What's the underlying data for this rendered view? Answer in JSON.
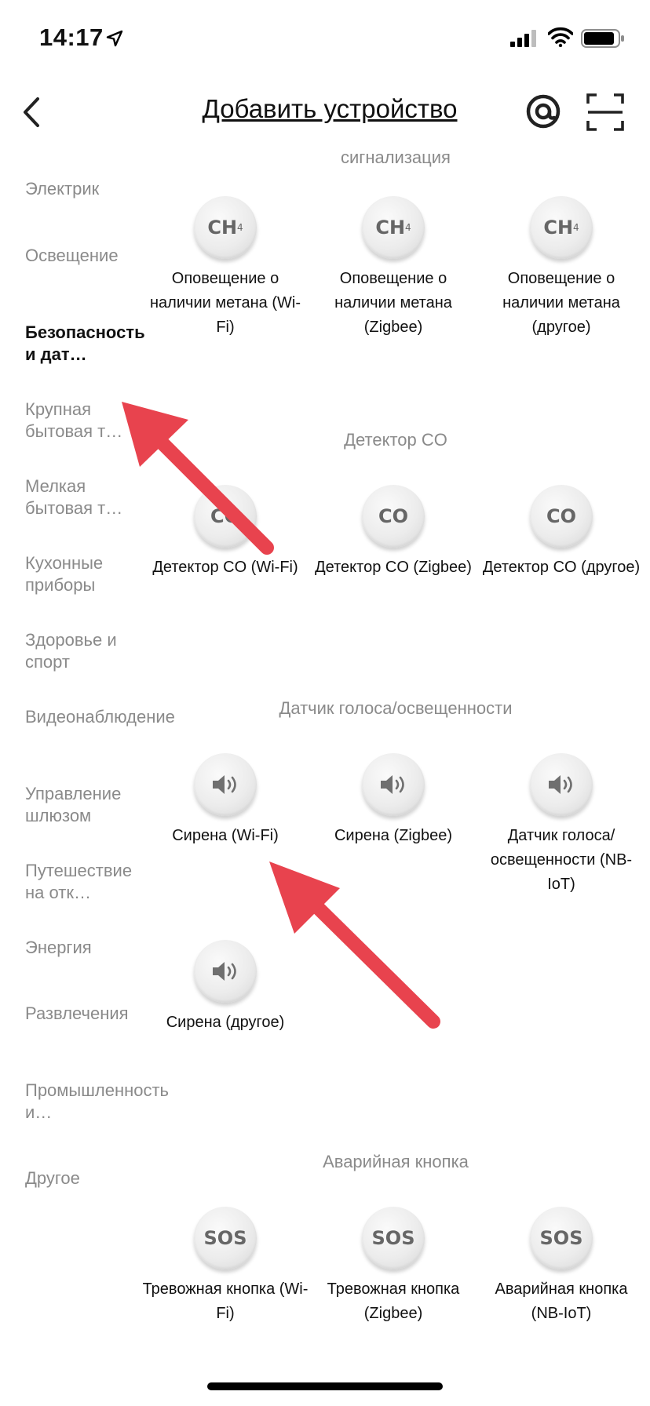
{
  "status": {
    "time": "14:17"
  },
  "nav": {
    "title": "Добавить устройство"
  },
  "sidebar": {
    "items": [
      {
        "label": "Электрик"
      },
      {
        "label": "Освещение"
      },
      {
        "label": "Безопасность и дат…"
      },
      {
        "label": "Крупная бытовая т…"
      },
      {
        "label": "Мелкая бытовая т…"
      },
      {
        "label": "Кухонные приборы"
      },
      {
        "label": "Здоровье и спорт"
      },
      {
        "label": "Видеонаблюдение"
      },
      {
        "label": "Управление шлюзом"
      },
      {
        "label": "Путешествие на отк…"
      },
      {
        "label": "Энергия"
      },
      {
        "label": "Развлечения"
      },
      {
        "label": "Промышленность и…"
      },
      {
        "label": "Другое"
      }
    ]
  },
  "content": {
    "top_partial": "сигнализация",
    "sections": [
      {
        "title": "",
        "devices": [
          {
            "icon": "CH4",
            "label": "Оповещение о наличии метана (Wi-Fi)"
          },
          {
            "icon": "CH4",
            "label": "Оповещение о наличии метана (Zigbee)"
          },
          {
            "icon": "CH4",
            "label": "Оповещение о наличии метана (другое)"
          }
        ]
      },
      {
        "title": "Детектор CO",
        "devices": [
          {
            "icon": "CO",
            "label": "Детектор CO (Wi-Fi)"
          },
          {
            "icon": "CO",
            "label": "Детектор CO (Zigbee)"
          },
          {
            "icon": "CO",
            "label": "Детектор CO (другое)"
          }
        ]
      },
      {
        "title": "Датчик голоса/освещенности",
        "devices": [
          {
            "icon": "speaker",
            "label": "Сирена (Wi-Fi)"
          },
          {
            "icon": "speaker",
            "label": "Сирена (Zigbee)"
          },
          {
            "icon": "speaker",
            "label": "Датчик голоса/ освещенности (NB-IoT)"
          },
          {
            "icon": "speaker",
            "label": "Сирена (другое)"
          }
        ]
      },
      {
        "title": "Аварийная кнопка",
        "devices": [
          {
            "icon": "SOS",
            "label": "Тревожная кнопка (Wi-Fi)"
          },
          {
            "icon": "SOS",
            "label": "Тревожная кнопка (Zigbee)"
          },
          {
            "icon": "SOS",
            "label": "Аварийная кнопка (NB-IoT)"
          }
        ]
      }
    ]
  },
  "colors": {
    "annotation_arrow": "#e8434e",
    "muted_text": "#8a8a8a"
  }
}
